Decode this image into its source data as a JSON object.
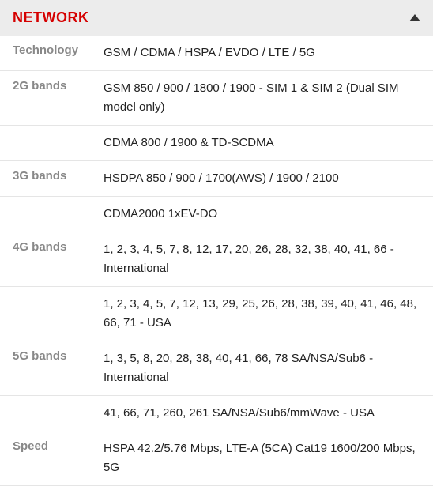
{
  "section": {
    "title": "NETWORK"
  },
  "specs": {
    "technology": {
      "label": "Technology",
      "value": "GSM / CDMA / HSPA / EVDO / LTE / 5G"
    },
    "bands2g": {
      "label": "2G bands",
      "value1": "GSM 850 / 900 / 1800 / 1900 - SIM 1 & SIM 2 (Dual SIM model only)",
      "value2": "CDMA 800 / 1900 & TD-SCDMA"
    },
    "bands3g": {
      "label": "3G bands",
      "value1": "HSDPA 850 / 900 / 1700(AWS) / 1900 / 2100",
      "value2": "CDMA2000 1xEV-DO"
    },
    "bands4g": {
      "label": "4G bands",
      "value1": "1, 2, 3, 4, 5, 7, 8, 12, 17, 20, 26, 28, 32, 38, 40, 41, 66 - International",
      "value2": "1, 2, 3, 4, 5, 7, 12, 13, 29, 25, 26, 28, 38, 39, 40, 41, 46, 48, 66, 71 - USA"
    },
    "bands5g": {
      "label": "5G bands",
      "value1": "1, 3, 5, 8, 20, 28, 38, 40, 41, 66, 78 SA/NSA/Sub6 - International",
      "value2": "41, 66, 71, 260, 261 SA/NSA/Sub6/mmWave - USA"
    },
    "speed": {
      "label": "Speed",
      "value": "HSPA 42.2/5.76 Mbps, LTE-A (5CA) Cat19 1600/200 Mbps, 5G"
    }
  }
}
